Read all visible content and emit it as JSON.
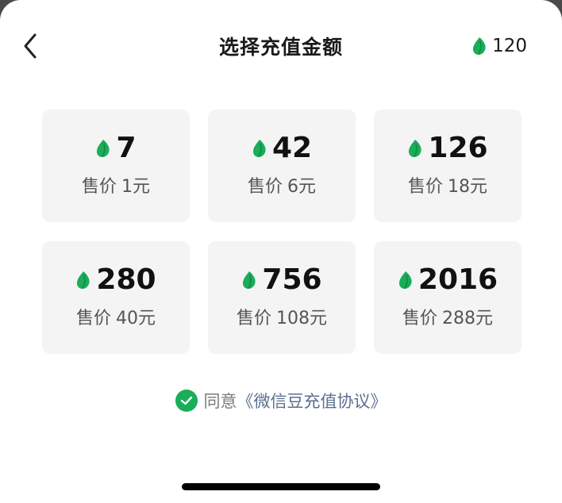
{
  "header": {
    "title": "选择充值金额",
    "balance": "120",
    "back_icon": "chevron-left-icon",
    "currency_icon": "wechat-bean-icon"
  },
  "options": [
    {
      "amount": "7",
      "price_label": "售价",
      "price": "1元"
    },
    {
      "amount": "42",
      "price_label": "售价",
      "price": "6元"
    },
    {
      "amount": "126",
      "price_label": "售价",
      "price": "18元"
    },
    {
      "amount": "280",
      "price_label": "售价",
      "price": "40元"
    },
    {
      "amount": "756",
      "price_label": "售价",
      "price": "108元"
    },
    {
      "amount": "2016",
      "price_label": "售价",
      "price": "288元"
    }
  ],
  "agreement": {
    "checked": true,
    "prefix": "同意",
    "link": "《微信豆充值协议》"
  },
  "colors": {
    "accent": "#1aad5a",
    "link": "#5a6f8f",
    "card_bg": "#f4f4f4"
  }
}
